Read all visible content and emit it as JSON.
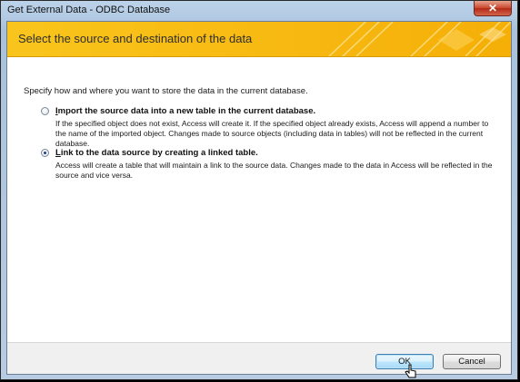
{
  "window": {
    "title": "Get External Data - ODBC Database",
    "close_glyph": "✕"
  },
  "banner": {
    "heading": "Select the source and destination of the data"
  },
  "instruction": "Specify how and where you want to store the data in the current database.",
  "options": [
    {
      "label_key": "I",
      "label_rest": "mport the source data into a new table in the current database.",
      "selected": false,
      "description": "If the specified object does not exist, Access will create it. If the specified object already exists, Access will append a number to the name of the imported object. Changes made to source objects (including data in tables) will not be reflected in the current database."
    },
    {
      "label_key": "L",
      "label_rest": "ink to the data source by creating a linked table.",
      "selected": true,
      "description": "Access will create a table that will maintain a link to the source data. Changes made to the data in Access will be reflected in the source and vice versa."
    }
  ],
  "buttons": {
    "ok": "OK",
    "cancel": "Cancel"
  },
  "colors": {
    "banner": "#f7b912",
    "window_frame": "#b7cce2",
    "close": "#c9452d"
  }
}
